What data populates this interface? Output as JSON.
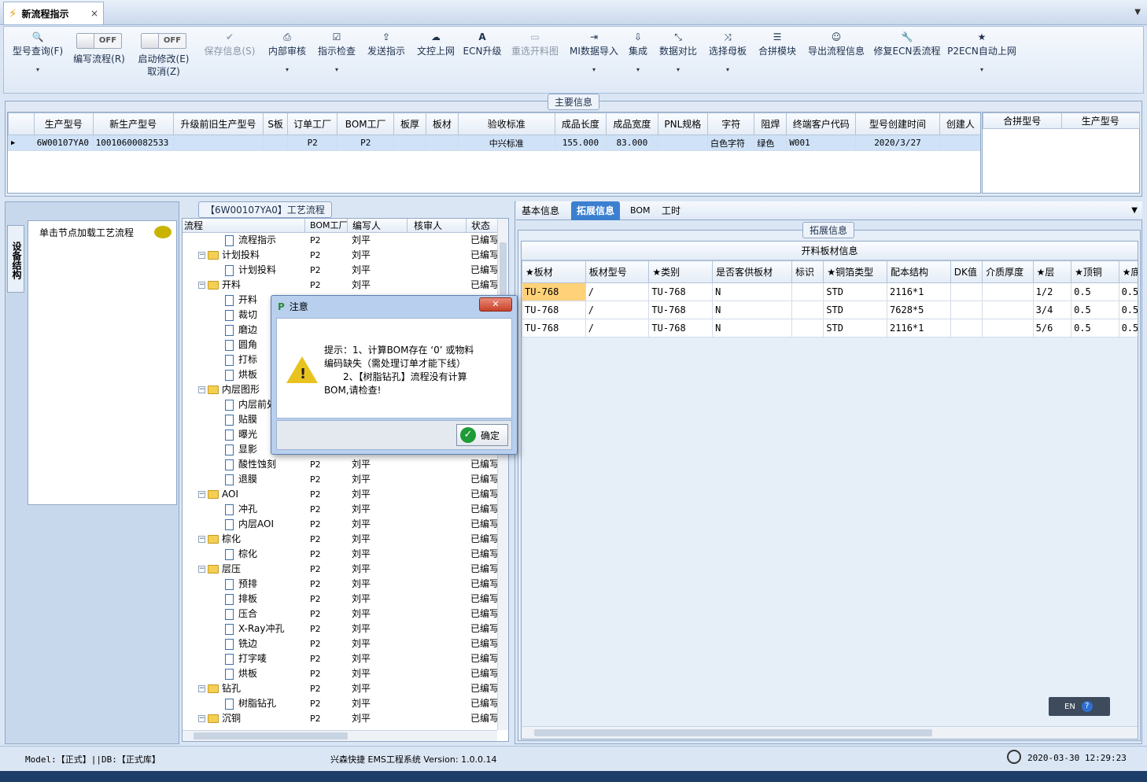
{
  "window": {
    "tab_title": "新流程指示",
    "close_glyph": "×",
    "dropdown_glyph": "▼"
  },
  "toolbar": {
    "items": [
      {
        "label": "型号查询(F)",
        "icon": "search-icon",
        "glyph": "🔍",
        "dropdown": true,
        "disabled": false
      },
      {
        "label": "编写流程(R)",
        "toggle": "OFF"
      },
      {
        "label": "启动修改(E)",
        "label2": "取消(Z)",
        "toggle": "OFF"
      },
      {
        "label": "保存信息(S)",
        "icon": "check-icon",
        "glyph": "✔",
        "disabled": true
      },
      {
        "label": "内部审核",
        "icon": "printer-icon",
        "glyph": "⎙",
        "dropdown": true
      },
      {
        "label": "指示检查",
        "icon": "checkbox-icon",
        "glyph": "☑",
        "dropdown": true
      },
      {
        "label": "发送指示",
        "icon": "upload-icon",
        "glyph": "⇪"
      },
      {
        "label": "文控上网",
        "icon": "cloud-upload-icon",
        "glyph": "☁"
      },
      {
        "label": "ECN升级",
        "icon": "font-icon",
        "glyph": "A"
      },
      {
        "label": "重选开料图",
        "icon": "image-icon",
        "glyph": "▭",
        "disabled": true
      },
      {
        "label": "MI数据导入",
        "icon": "import-icon",
        "glyph": "⇥",
        "dropdown": true
      },
      {
        "label": "集成",
        "icon": "download-icon",
        "glyph": "⇩",
        "dropdown": true
      },
      {
        "label": "数据对比",
        "icon": "compress-icon",
        "glyph": "⤡",
        "dropdown": true
      },
      {
        "label": "选择母板",
        "icon": "shuffle-icon",
        "glyph": "⤨",
        "dropdown": true
      },
      {
        "label": "合拼模块",
        "icon": "list-icon",
        "glyph": "☰"
      },
      {
        "label": "导出流程信息",
        "icon": "smile-icon",
        "glyph": "☺"
      },
      {
        "label": "修复ECN丢流程",
        "icon": "wrench-icon",
        "glyph": "🔧"
      },
      {
        "label": "P2ECN自动上网",
        "icon": "star-icon",
        "glyph": "★",
        "dropdown": true
      }
    ],
    "dropdown_glyph": "▾"
  },
  "main_info": {
    "section_title": "主要信息",
    "headers": [
      "生产型号",
      "新生产型号",
      "升级前旧生产型号",
      "S板",
      "订单工厂",
      "BOM工厂",
      "板厚",
      "板材",
      "验收标准",
      "成品长度",
      "成品宽度",
      "PNL规格",
      "字符",
      "阻焊",
      "终端客户代码",
      "型号创建时间",
      "创建人"
    ],
    "row": [
      "6W00107YA0",
      "10010600082533",
      "",
      "",
      "P2",
      "P2",
      "",
      "",
      "中兴标准",
      "155.000",
      "83.000",
      "",
      "白色字符",
      "绿色",
      "W001",
      "2020/3/27",
      ""
    ],
    "side_headers": [
      "合拼型号",
      "生产型号"
    ]
  },
  "left_panel": {
    "vertical_tab": "设备结构",
    "node_hint": "单击节点加载工艺流程"
  },
  "flow": {
    "title": "【6W00107YA0】工艺流程",
    "headers": [
      "流程",
      "BOM工厂",
      "编写人",
      "核审人",
      "状态"
    ],
    "rows": [
      {
        "level": 1,
        "type": "doc",
        "name": "流程指示",
        "bom": "P2",
        "writer": "刘平",
        "status": "已编写"
      },
      {
        "level": 0,
        "type": "folder",
        "name": "计划投料",
        "bom": "P2",
        "writer": "刘平",
        "status": "已编写"
      },
      {
        "level": 1,
        "type": "doc",
        "name": "计划投料",
        "bom": "P2",
        "writer": "刘平",
        "status": "已编写"
      },
      {
        "level": 0,
        "type": "folder",
        "name": "开料",
        "bom": "P2",
        "writer": "刘平",
        "status": "已编写"
      },
      {
        "level": 1,
        "type": "doc",
        "name": "开料",
        "bom": "P2",
        "writer": "刘平",
        "status": "已编写"
      },
      {
        "level": 1,
        "type": "doc",
        "name": "裁切",
        "bom": "P2",
        "writer": "刘平",
        "status": "已编写"
      },
      {
        "level": 1,
        "type": "doc",
        "name": "磨边",
        "bom": "P2",
        "writer": "刘平",
        "status": "已编写"
      },
      {
        "level": 1,
        "type": "doc",
        "name": "圆角",
        "bom": "P2",
        "writer": "刘平",
        "status": "已编写"
      },
      {
        "level": 1,
        "type": "doc",
        "name": "打标",
        "bom": "P2",
        "writer": "刘平",
        "status": "已编写"
      },
      {
        "level": 1,
        "type": "doc",
        "name": "烘板",
        "bom": "P2",
        "writer": "刘平",
        "status": "已编写"
      },
      {
        "level": 0,
        "type": "folder",
        "name": "内层图形",
        "bom": "P2",
        "writer": "刘平",
        "status": "已编写"
      },
      {
        "level": 1,
        "type": "doc",
        "name": "内层前处理",
        "bom": "P2",
        "writer": "刘平",
        "status": "已编写"
      },
      {
        "level": 1,
        "type": "doc",
        "name": "贴膜",
        "bom": "P2",
        "writer": "刘平",
        "status": "已编写"
      },
      {
        "level": 1,
        "type": "doc",
        "name": "曝光",
        "bom": "P2",
        "writer": "刘平",
        "status": "已编写"
      },
      {
        "level": 1,
        "type": "doc",
        "name": "显影",
        "bom": "P2",
        "writer": "刘平",
        "status": "已编写"
      },
      {
        "level": 1,
        "type": "doc",
        "name": "酸性蚀刻",
        "bom": "P2",
        "writer": "刘平",
        "status": "已编写"
      },
      {
        "level": 1,
        "type": "doc",
        "name": "退膜",
        "bom": "P2",
        "writer": "刘平",
        "status": "已编写"
      },
      {
        "level": 0,
        "type": "folder",
        "name": "AOI",
        "bom": "P2",
        "writer": "刘平",
        "status": "已编写"
      },
      {
        "level": 1,
        "type": "doc",
        "name": "冲孔",
        "bom": "P2",
        "writer": "刘平",
        "status": "已编写"
      },
      {
        "level": 1,
        "type": "doc",
        "name": "内层AOI",
        "bom": "P2",
        "writer": "刘平",
        "status": "已编写"
      },
      {
        "level": 0,
        "type": "folder",
        "name": "棕化",
        "bom": "P2",
        "writer": "刘平",
        "status": "已编写"
      },
      {
        "level": 1,
        "type": "doc",
        "name": "棕化",
        "bom": "P2",
        "writer": "刘平",
        "status": "已编写"
      },
      {
        "level": 0,
        "type": "folder",
        "name": "层压",
        "bom": "P2",
        "writer": "刘平",
        "status": "已编写"
      },
      {
        "level": 1,
        "type": "doc",
        "name": "预排",
        "bom": "P2",
        "writer": "刘平",
        "status": "已编写"
      },
      {
        "level": 1,
        "type": "doc",
        "name": "排板",
        "bom": "P2",
        "writer": "刘平",
        "status": "已编写"
      },
      {
        "level": 1,
        "type": "doc",
        "name": "压合",
        "bom": "P2",
        "writer": "刘平",
        "status": "已编写"
      },
      {
        "level": 1,
        "type": "doc",
        "name": "X-Ray冲孔",
        "bom": "P2",
        "writer": "刘平",
        "status": "已编写"
      },
      {
        "level": 1,
        "type": "doc",
        "name": "铣边",
        "bom": "P2",
        "writer": "刘平",
        "status": "已编写"
      },
      {
        "level": 1,
        "type": "doc",
        "name": "打字唛",
        "bom": "P2",
        "writer": "刘平",
        "status": "已编写"
      },
      {
        "level": 1,
        "type": "doc",
        "name": "烘板",
        "bom": "P2",
        "writer": "刘平",
        "status": "已编写"
      },
      {
        "level": 0,
        "type": "folder",
        "name": "钻孔",
        "bom": "P2",
        "writer": "刘平",
        "status": "已编写"
      },
      {
        "level": 1,
        "type": "doc",
        "name": "树脂钻孔",
        "bom": "P2",
        "writer": "刘平",
        "status": "已编写"
      },
      {
        "level": 0,
        "type": "folder",
        "name": "沉铜",
        "bom": "P2",
        "writer": "刘平",
        "status": "已编写"
      }
    ]
  },
  "right_tabs": {
    "tabs": [
      "基本信息",
      "拓展信息",
      "BOM",
      "工时"
    ],
    "active": 1
  },
  "ext_info": {
    "section_title": "拓展信息",
    "table_title": "开料板材信息",
    "headers": [
      "★板材",
      "板材型号",
      "★类别",
      "是否客供板材",
      "标识",
      "★铜箔类型",
      "配本结构",
      "DK值",
      "介质厚度",
      "★层",
      "★顶铜",
      "★底"
    ],
    "rows": [
      [
        "TU-768",
        "/",
        "TU-768",
        "N",
        "",
        "STD",
        "2116*1",
        "",
        "",
        "1/2",
        "0.5",
        "0.5"
      ],
      [
        "TU-768",
        "/",
        "TU-768",
        "N",
        "",
        "STD",
        "7628*5",
        "",
        "",
        "3/4",
        "0.5",
        "0.5"
      ],
      [
        "TU-768",
        "/",
        "TU-768",
        "N",
        "",
        "STD",
        "2116*1",
        "",
        "",
        "5/6",
        "0.5",
        "0.5"
      ]
    ]
  },
  "dialog": {
    "title": "注意",
    "message_lines": [
      "提示：1、计算BOM存在 ‘0’ 或物料",
      "编码缺失（需处理订单才能下线）",
      "　　2、【树脂钻孔】流程没有计算",
      "BOM,请检查!"
    ],
    "ok_label": "确定",
    "close_glyph": "✕"
  },
  "ime": {
    "lang": "EN",
    "help": "?"
  },
  "status": {
    "left": "Model:【正式】||DB:【正式库】",
    "center": "兴森快捷 EMS工程系统 Version: 1.0.0.14",
    "datetime": "2020-03-30 12:29:23"
  },
  "colors": {
    "accent": "#3b7fd0",
    "selected_row": "#cfe2f8",
    "highlight_cell": "#ffd27a",
    "folder": "#f3cf53",
    "ok_green": "#1e9a36",
    "warn_yellow": "#e8c320"
  }
}
